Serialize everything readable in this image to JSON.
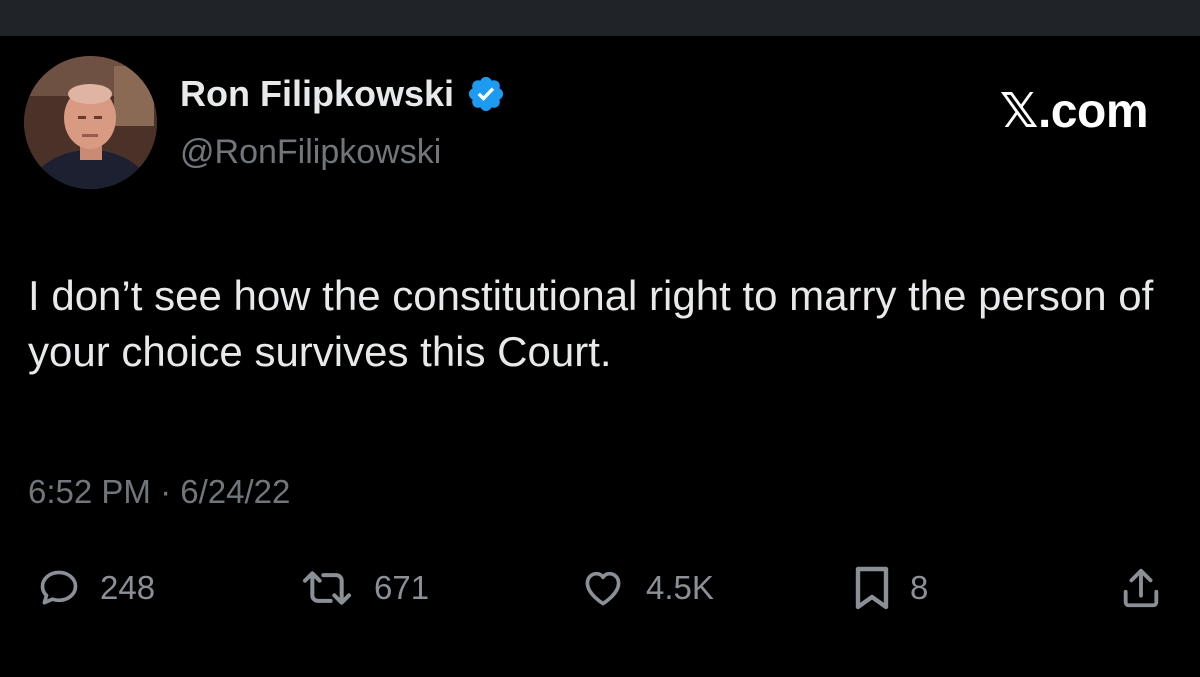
{
  "author": {
    "display_name": "Ron Filipkowski",
    "handle": "@RonFilipkowski",
    "verified": true
  },
  "brand": "𝕏.com",
  "tweet": {
    "text": "I don’t see how the constitutional right to marry the person of your choice survives this Court.",
    "timestamp": "6:52 PM · 6/24/22"
  },
  "actions": {
    "reply_count": "248",
    "retweet_count": "671",
    "like_count": "4.5K",
    "bookmark_count": "8"
  },
  "icons": {
    "reply": "reply-icon",
    "retweet": "retweet-icon",
    "like": "heart-icon",
    "bookmark": "bookmark-icon",
    "share": "share-icon",
    "verified": "verified-badge-icon"
  },
  "colors": {
    "background": "#000000",
    "text": "#e7e9ea",
    "muted": "#71767b",
    "verified_blue": "#1d9bf0"
  }
}
